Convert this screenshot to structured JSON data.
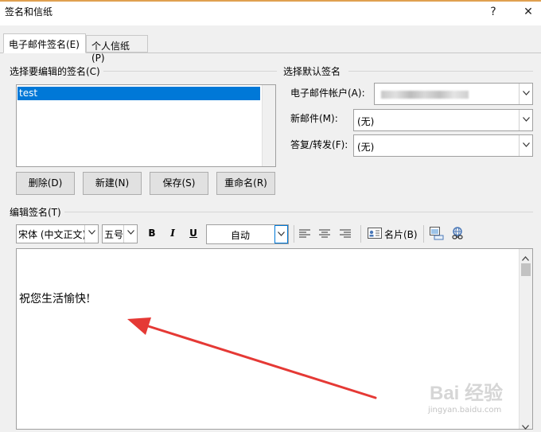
{
  "window": {
    "title": "签名和信纸",
    "help": "?",
    "close": "✕"
  },
  "tabs": [
    {
      "label": "电子邮件签名(E)"
    },
    {
      "label": "个人信纸(P)"
    }
  ],
  "select_signature": {
    "heading": "选择要编辑的签名(C)",
    "items": [
      {
        "label": "test"
      }
    ],
    "buttons": {
      "delete": "删除(D)",
      "new": "新建(N)",
      "save": "保存(S)",
      "rename": "重命名(R)"
    }
  },
  "default_signature": {
    "heading": "选择默认签名",
    "account_label": "电子邮件帐户(A):",
    "new_messages_label": "新邮件(M):",
    "new_messages_value": "(无)",
    "replies_label": "答复/转发(F):",
    "replies_value": "(无)"
  },
  "edit_signature": {
    "heading": "编辑签名(T)",
    "font": "宋体 (中文正文)",
    "size": "五号",
    "bold": "B",
    "italic": "I",
    "underline": "U",
    "color": "自动",
    "business_card": "名片(B)",
    "content": "祝您生活愉快!"
  },
  "colors": {
    "selection": "#0078d7",
    "arrow": "#e53935"
  },
  "watermark": {
    "text": "Bai 经验",
    "sub": "jingyan.baidu.com"
  }
}
